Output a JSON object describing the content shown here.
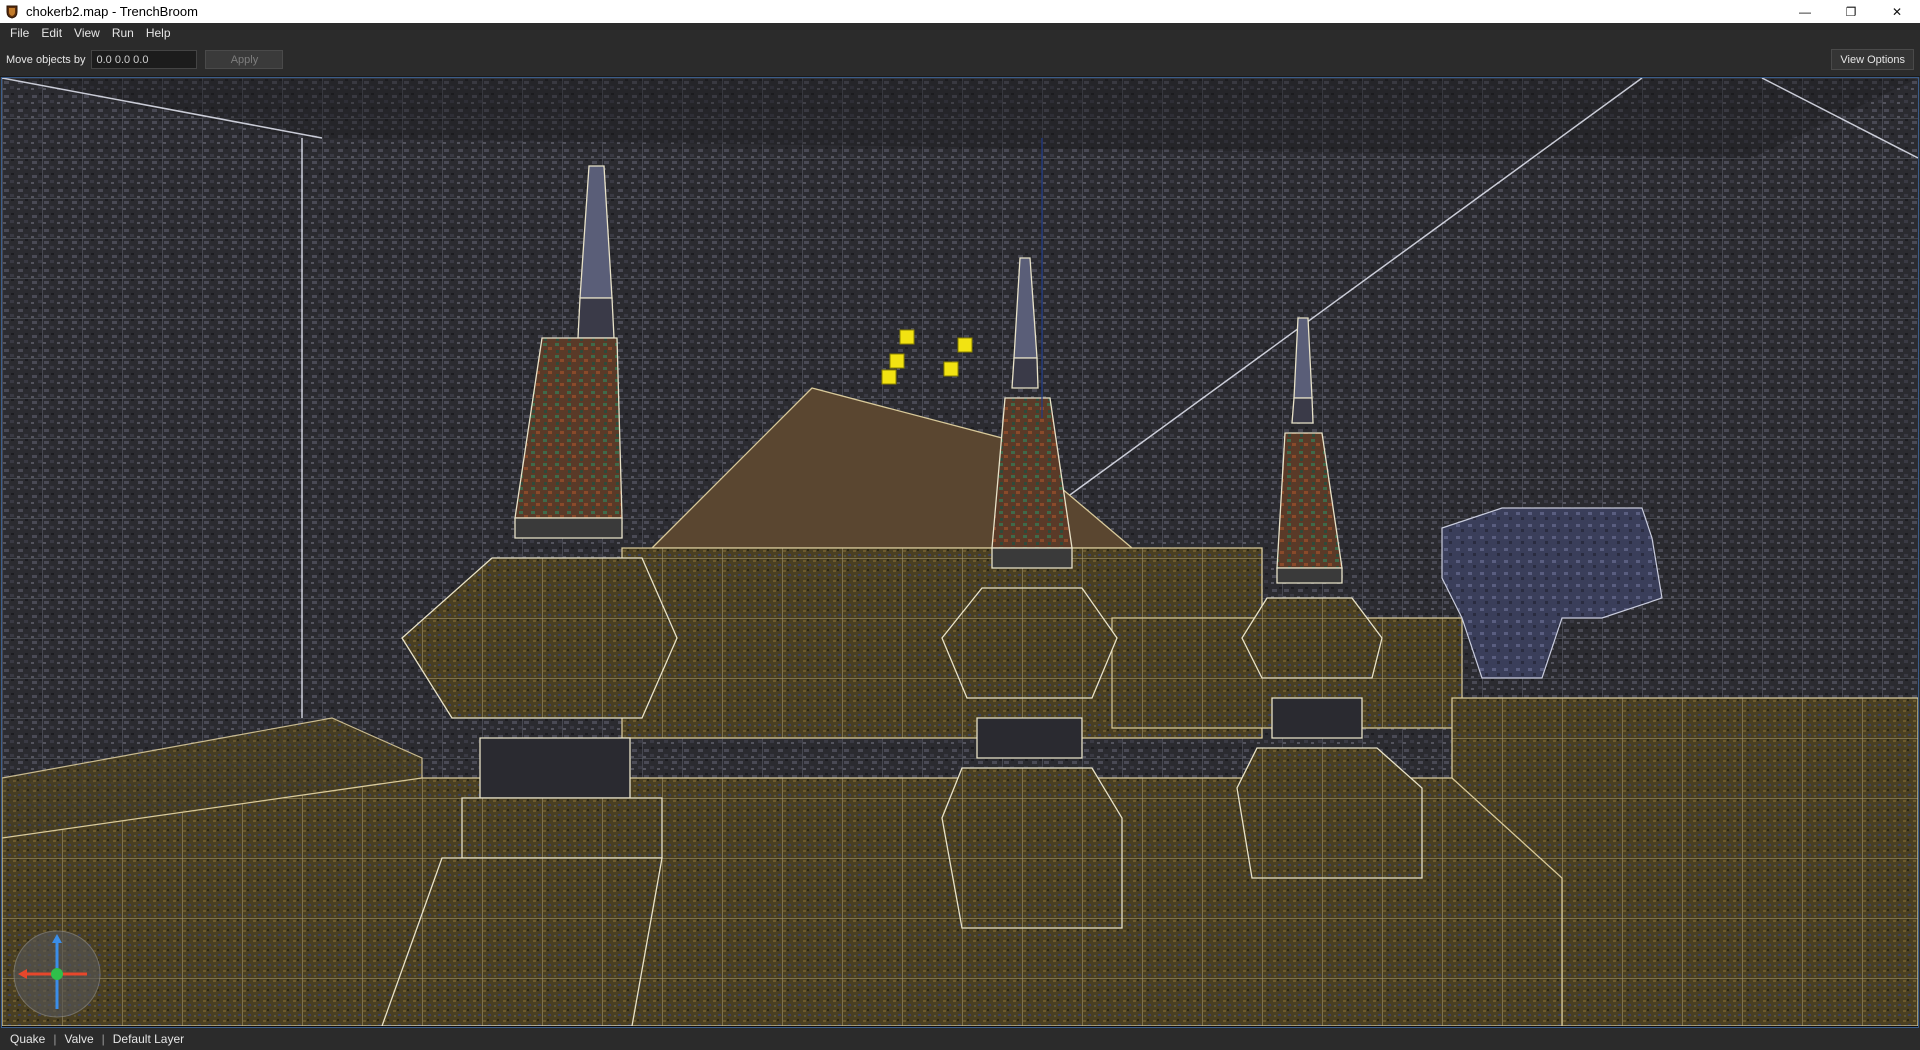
{
  "window": {
    "title": "chokerb2.map - TrenchBroom",
    "controls": {
      "minimize": "—",
      "restore": "❐",
      "close": "✕"
    }
  },
  "menu": {
    "items": [
      "File",
      "Edit",
      "View",
      "Run",
      "Help"
    ]
  },
  "toolbar": {
    "move_label": "Move objects by",
    "move_value": "0.0 0.0 0.0",
    "apply_label": "Apply",
    "view_options_label": "View Options"
  },
  "statusbar": {
    "game": "Quake",
    "format": "Valve",
    "layer": "Default Layer"
  },
  "icons": {
    "app": "trenchbroom-shield-icon",
    "gizmo": "axis-orientation-gizmo-icon"
  },
  "colors": {
    "accent_border": "#3b5d8a",
    "selection_yellow": "#f2e312"
  }
}
